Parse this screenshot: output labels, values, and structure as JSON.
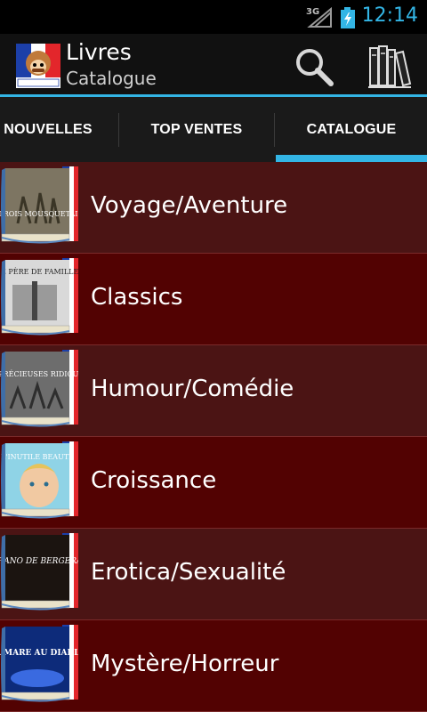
{
  "status": {
    "network": "3G",
    "time": "12:14",
    "clock_color": "#33b5e5"
  },
  "action_bar": {
    "title": "Livres",
    "subtitle": "Catalogue",
    "logo_icon": "livres-francais-logo-icon",
    "search_icon": "search-icon",
    "bookshelf_icon": "bookshelf-icon"
  },
  "tabs": [
    {
      "label": "NOUVELLES",
      "selected": false
    },
    {
      "label": "TOP VENTES",
      "selected": false
    },
    {
      "label": "CATALOGUE",
      "selected": true
    }
  ],
  "accent_color": "#33b5e5",
  "categories": [
    {
      "label": "Voyage/Aventure",
      "cover_title": "LES TROIS MOUSQUETAIRES"
    },
    {
      "label": "Classics",
      "cover_title": "LE PÈRE DE FAMILLE"
    },
    {
      "label": "Humour/Comédie",
      "cover_title": "LES PRÉCIEUSES RIDICULES"
    },
    {
      "label": "Croissance",
      "cover_title": "L'INUTILE BEAUTÉ"
    },
    {
      "label": "Erotica/Sexualité",
      "cover_title": "CYRANO DE BERGERAC"
    },
    {
      "label": "Mystère/Horreur",
      "cover_title": "LA MARE AU DIABLE"
    }
  ]
}
